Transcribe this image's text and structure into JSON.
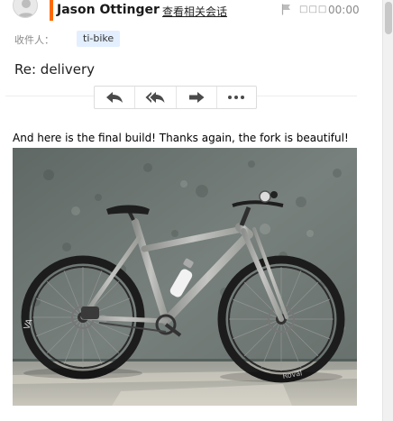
{
  "header": {
    "sender_name": "Jason Ottinger",
    "view_conversation_label": "查看相关会话",
    "status_text": "□□□",
    "time": "00:00"
  },
  "recipients": {
    "label": "收件人：",
    "items": [
      {
        "name": "ti-bike"
      }
    ]
  },
  "subject": "Re: delivery",
  "toolbar": {
    "buttons": [
      {
        "name": "reply",
        "icon": "reply-icon"
      },
      {
        "name": "reply-all",
        "icon": "reply-all-icon"
      },
      {
        "name": "forward",
        "icon": "forward-icon"
      },
      {
        "name": "more",
        "icon": "more-icon"
      }
    ]
  },
  "message": {
    "text": "And here is the final build! Thanks again, the fork is beautiful!"
  },
  "attachment": {
    "subject": "titanium mountain bike leaning against a grey stucco wall",
    "rim_lettering_left": "VA",
    "rim_lettering_right": "Roval"
  },
  "colors": {
    "accent": "#ff6a00",
    "recipient_tag_bg": "#e3efff",
    "wall": "#6b7470"
  }
}
